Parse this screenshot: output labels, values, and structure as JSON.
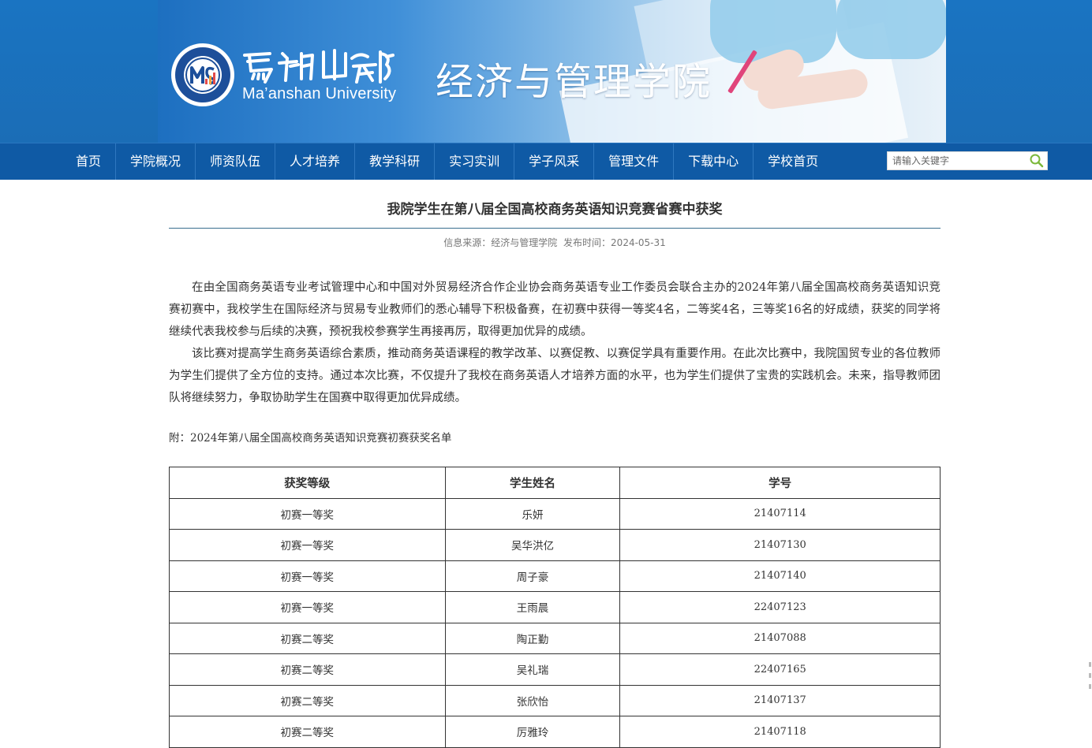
{
  "header": {
    "school_name_en": "Ma’anshan University",
    "college_name": "经济与管理学院"
  },
  "nav": {
    "items": [
      {
        "label": "首页"
      },
      {
        "label": "学院概况"
      },
      {
        "label": "师资队伍"
      },
      {
        "label": "人才培养"
      },
      {
        "label": "教学科研"
      },
      {
        "label": "实习实训"
      },
      {
        "label": "学子风采"
      },
      {
        "label": "管理文件"
      },
      {
        "label": "下载中心"
      },
      {
        "label": "学校首页"
      }
    ],
    "search": {
      "placeholder": "请输入关键字",
      "icon": "magnifier-icon",
      "icon_color": "#7bb83a"
    }
  },
  "article": {
    "title": "我院学生在第八届全国高校商务英语知识竞赛省赛中获奖",
    "source_label": "信息来源：经济与管理学院",
    "date_label": "发布时间：2024-05-31",
    "paragraphs": [
      "在由全国商务英语专业考试管理中心和中国对外贸易经济合作企业协会商务英语专业工作委员会联合主办的2024年第八届全国高校商务英语知识竞赛初赛中，我校学生在国际经济与贸易专业教师们的悉心辅导下积极备赛，在初赛中获得一等奖4名，二等奖4名，三等奖16名的好成绩，获奖的同学将继续代表我校参与后续的决赛，预祝我校参赛学生再接再厉，取得更加优异的成绩。",
      "该比赛对提高学生商务英语综合素质，推动商务英语课程的教学改革、以赛促教、以赛促学具有重要作用。在此次比赛中，我院国贸专业的各位教师为学生们提供了全方位的支持。通过本次比赛，不仅提升了我校在商务英语人才培养方面的水平，也为学生们提供了宝贵的实践机会。未来，指导教师团队将继续努力，争取协助学生在国赛中取得更加优异成绩。"
    ],
    "attachment": "附：2024年第八届全国高校商务英语知识竞赛初赛获奖名单",
    "table": {
      "headers": [
        "获奖等级",
        "学生姓名",
        "学号"
      ],
      "rows": [
        [
          "初赛一等奖",
          "乐妍",
          "21407114"
        ],
        [
          "初赛一等奖",
          "吴华洪亿",
          "21407130"
        ],
        [
          "初赛一等奖",
          "周子豪",
          "21407140"
        ],
        [
          "初赛一等奖",
          "王雨晨",
          "22407123"
        ],
        [
          "初赛二等奖",
          "陶正勤",
          "21407088"
        ],
        [
          "初赛二等奖",
          "吴礼瑞",
          "22407165"
        ],
        [
          "初赛二等奖",
          "张欣怡",
          "21407137"
        ],
        [
          "初赛二等奖",
          "厉雅玲",
          "21407118"
        ]
      ]
    }
  },
  "colors": {
    "header_blue": "#1a74c2",
    "nav_blue": "#0f5aa5",
    "rule": "#3a6f8f"
  }
}
